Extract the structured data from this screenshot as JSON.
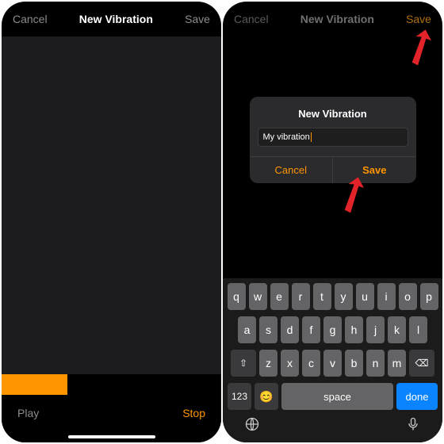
{
  "left": {
    "nav": {
      "cancel": "Cancel",
      "title": "New Vibration",
      "save": "Save"
    },
    "bottom": {
      "play": "Play",
      "stop": "Stop"
    },
    "progress_pct": 30
  },
  "right": {
    "nav": {
      "cancel": "Cancel",
      "title": "New Vibration",
      "save": "Save"
    },
    "alert": {
      "title": "New Vibration",
      "input_value": "My vibration",
      "cancel": "Cancel",
      "save": "Save"
    },
    "keyboard": {
      "row1": [
        "q",
        "w",
        "e",
        "r",
        "t",
        "y",
        "u",
        "i",
        "o",
        "p"
      ],
      "row2": [
        "a",
        "s",
        "d",
        "f",
        "g",
        "h",
        "j",
        "k",
        "l"
      ],
      "row3": [
        "z",
        "x",
        "c",
        "v",
        "b",
        "n",
        "m"
      ],
      "shift": "⇧",
      "backspace": "⌫",
      "numbers": "123",
      "emoji": "😊",
      "space": "space",
      "done": "done"
    }
  },
  "accent": "#ff9500"
}
